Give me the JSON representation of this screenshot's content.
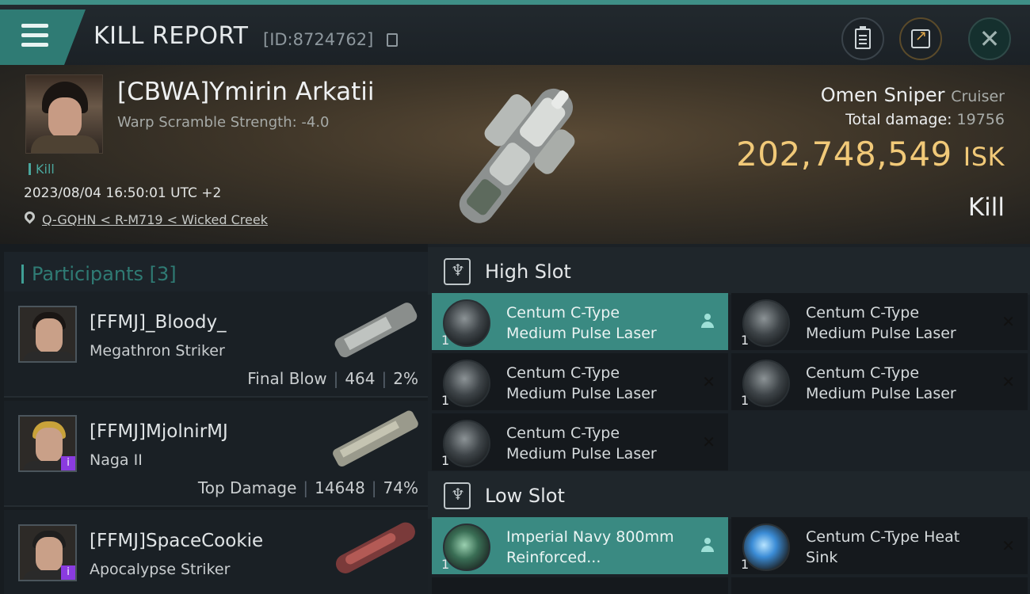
{
  "header": {
    "title": "KILL REPORT",
    "report_id": "[ID:8724762]"
  },
  "victim": {
    "name": "[CBWA]Ymirin Arkatii",
    "stat": "Warp Scramble Strength: -4.0",
    "tag": "Kill",
    "datetime": "2023/08/04 16:50:01 UTC +2",
    "location": "Q-GQHN < R-M719 < Wicked Creek",
    "ship_name": "Omen Sniper",
    "ship_class": "Cruiser",
    "total_damage_label": "Total damage:",
    "total_damage": "19756",
    "isk_value": "202,748,549",
    "isk_unit": "ISK",
    "result": "Kill"
  },
  "participants": {
    "heading": "Participants [3]",
    "items": [
      {
        "name": "[FFMJ]_Bloody_",
        "ship": "Megathron Striker",
        "label": "Final Blow",
        "damage": "464",
        "percent": "2%",
        "hair": "#1a1614",
        "badge": false
      },
      {
        "name": "[FFMJ]MjolnirMJ",
        "ship": "Naga II",
        "label": "Top Damage",
        "damage": "14648",
        "percent": "74%",
        "hair": "#c9a23a",
        "badge": true
      },
      {
        "name": "[FFMJ]SpaceCookie",
        "ship": "Apocalypse Striker",
        "label": "",
        "damage": "",
        "percent": "",
        "hair": "#1e1e1e",
        "badge": true
      }
    ]
  },
  "high_slot": {
    "title": "High Slot",
    "modules": [
      {
        "name": "Centum C-Type Medium Pulse Laser",
        "qty": "1"
      },
      {
        "name": "Centum C-Type Medium Pulse Laser",
        "qty": "1"
      },
      {
        "name": "Centum C-Type Medium Pulse Laser",
        "qty": "1"
      },
      {
        "name": "Centum C-Type Medium Pulse Laser",
        "qty": "1"
      },
      {
        "name": "Centum C-Type Medium Pulse Laser",
        "qty": "1"
      }
    ]
  },
  "low_slot": {
    "title": "Low Slot",
    "modules": [
      {
        "name": "Imperial Navy 800mm Reinforced...",
        "qty": "1"
      },
      {
        "name": "Centum C-Type Heat Sink",
        "qty": "1"
      }
    ]
  },
  "colors": {
    "accent": "#3f8f87",
    "isk": "#f1c978",
    "active_module": "#3a8a82"
  }
}
